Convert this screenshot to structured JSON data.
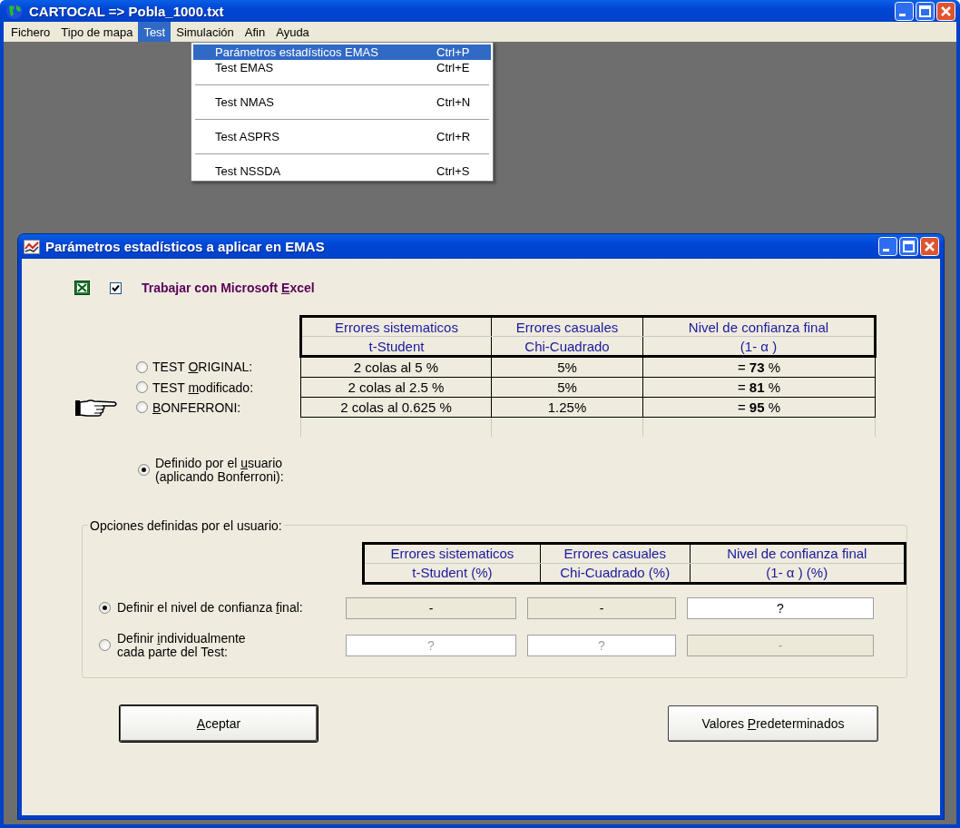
{
  "window": {
    "title": "CARTOCAL => Pobla_1000.txt"
  },
  "menu_bar": [
    {
      "label": "Fichero",
      "selected": false
    },
    {
      "label": "Tipo de mapa",
      "selected": false
    },
    {
      "label": "Test",
      "selected": true
    },
    {
      "label": "Simulación",
      "selected": false
    },
    {
      "label": "Afin",
      "selected": false
    },
    {
      "label": "Ayuda",
      "selected": false
    }
  ],
  "dropdown": [
    {
      "label": "Parámetros estadísticos EMAS",
      "shortcut": "Ctrl+P",
      "selected": true
    },
    {
      "label": "Test EMAS",
      "shortcut": "Ctrl+E",
      "selected": false
    },
    {
      "label": "Test NMAS",
      "shortcut": "Ctrl+N",
      "selected": false
    },
    {
      "label": "Test ASPRS",
      "shortcut": "Ctrl+R",
      "selected": false
    },
    {
      "label": "Test NSSDA",
      "shortcut": "Ctrl+S",
      "selected": false
    }
  ],
  "dialog": {
    "title": "Parámetros estadísticos a aplicar en EMAS",
    "excel_checkbox": {
      "label": [
        {
          "text": "Trabajar con Microsoft "
        },
        {
          "text": "E",
          "underline": true
        },
        {
          "text": "xcel"
        }
      ],
      "checked": true
    },
    "table": {
      "columns": [
        {
          "title": "Errores sistematicos",
          "subtitle": "t-Student"
        },
        {
          "title": "Errores casuales",
          "subtitle": "Chi-Cuadrado"
        },
        {
          "title": "Nivel de confianza final",
          "subtitle": "(1- α )"
        }
      ],
      "rows": [
        {
          "option": [
            {
              "text": "TEST "
            },
            {
              "text": "O",
              "underline": true
            },
            {
              "text": "RIGINAL:"
            }
          ],
          "selected": false,
          "pointer": false,
          "cells": [
            "2 colas al 5 %",
            "5%",
            "= **73** %"
          ]
        },
        {
          "option": [
            {
              "text": "TEST "
            },
            {
              "text": "m",
              "underline": true
            },
            {
              "text": "odificado:"
            }
          ],
          "selected": false,
          "pointer": false,
          "cells": [
            "2 colas al 2.5 %",
            "5%",
            "= **81** %"
          ]
        },
        {
          "option": [
            {
              "text": "B",
              "underline": true
            },
            {
              "text": "ONFERRONI:"
            }
          ],
          "selected": false,
          "pointer": true,
          "cells": [
            "2 colas al 0.625 %",
            "1.25%",
            "= **95** %"
          ]
        }
      ]
    },
    "user_option": {
      "lines": [
        [
          {
            "text": "Definido por el "
          },
          {
            "text": "u",
            "underline": true
          },
          {
            "text": "suario"
          }
        ],
        [
          {
            "text": "(aplicando Bonferroni):"
          }
        ]
      ],
      "selected": true
    },
    "group": {
      "title": "Opciones definidas por el usuario:",
      "columns": [
        {
          "title": "Errores sistematicos",
          "subtitle": "t-Student (%)"
        },
        {
          "title": "Errores casuales",
          "subtitle": "Chi-Cuadrado (%)"
        },
        {
          "title": "Nivel de confianza final",
          "subtitle": "(1- α ) (%)"
        }
      ],
      "rows": [
        {
          "lines": [
            [
              {
                "text": "Definir el nivel de confianza "
              },
              {
                "text": "f",
                "underline": true
              },
              {
                "text": "inal:"
              }
            ]
          ],
          "selected": true,
          "fields": [
            {
              "value": "-",
              "editable": false
            },
            {
              "value": "-",
              "editable": false
            },
            {
              "value": "?",
              "editable": true
            }
          ]
        },
        {
          "lines": [
            [
              {
                "text": "Definir "
              },
              {
                "text": "i",
                "underline": true
              },
              {
                "text": "ndividualmente"
              }
            ],
            [
              {
                "text": "cada parte del Test:"
              }
            ]
          ],
          "selected": false,
          "fields": [
            {
              "value": "?",
              "editable": true
            },
            {
              "value": "?",
              "editable": true
            },
            {
              "value": "-",
              "editable": false
            }
          ]
        }
      ]
    },
    "buttons": [
      {
        "label": [
          {
            "text": "A",
            "underline": true
          },
          {
            "text": "ceptar"
          }
        ],
        "kind": "default"
      },
      {
        "label": [
          {
            "text": "Valores "
          },
          {
            "text": "P",
            "underline": true
          },
          {
            "text": "redeterminados"
          }
        ],
        "kind": "normal"
      }
    ]
  }
}
